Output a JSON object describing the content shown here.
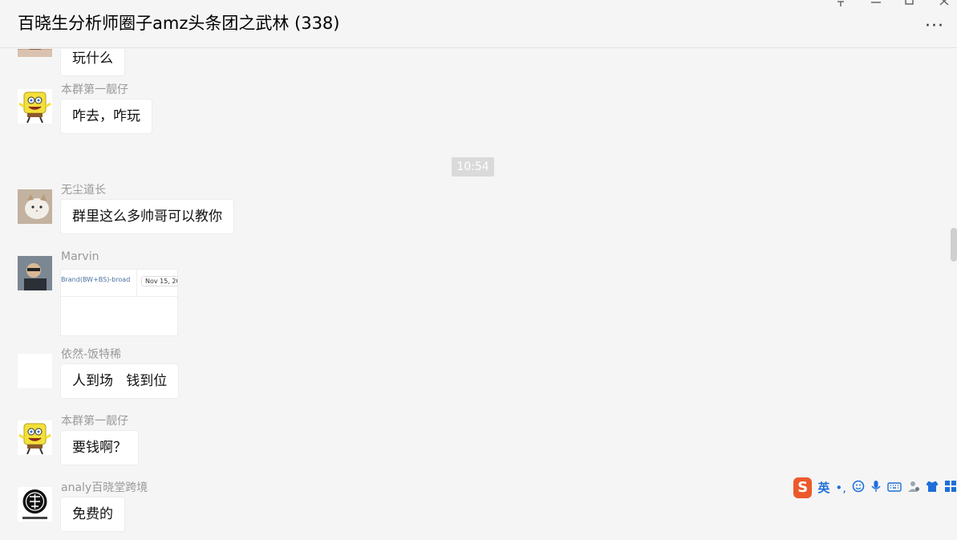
{
  "window": {
    "title": "百晓生分析师圈子amz头条团之武林 (338)",
    "more_label": "···"
  },
  "chat": {
    "timestamp": "10:54",
    "messages": [
      {
        "sender": "",
        "text": "玩什么"
      },
      {
        "sender": "本群第一靓仔",
        "text": "咋去，咋玩"
      },
      {
        "sender": "无尘道长",
        "text": "群里这么多帅哥可以教你"
      },
      {
        "sender": "Marvin",
        "image": {
          "caption_left": "Brand(BW+BS)-broad",
          "caption_right": "Nov 15, 20"
        }
      },
      {
        "sender": "依然-饭特稀",
        "text": "人到场   钱到位"
      },
      {
        "sender": "本群第一靓仔",
        "text": "要钱啊？"
      },
      {
        "sender": "analy百晓堂跨境",
        "text": "免费的"
      }
    ]
  },
  "ime": {
    "logo": "S",
    "lang": "英",
    "punct": "•,",
    "icons": [
      "emoji-icon",
      "mic-icon",
      "keyboard-icon",
      "user-icon",
      "skin-icon",
      "toolbox-icon"
    ]
  },
  "colors": {
    "background": "#f5f5f5",
    "bubble": "#ffffff",
    "sender_name": "#999999",
    "ime_accent": "#1e6fd9",
    "ime_logo": "#ec5a2b"
  }
}
